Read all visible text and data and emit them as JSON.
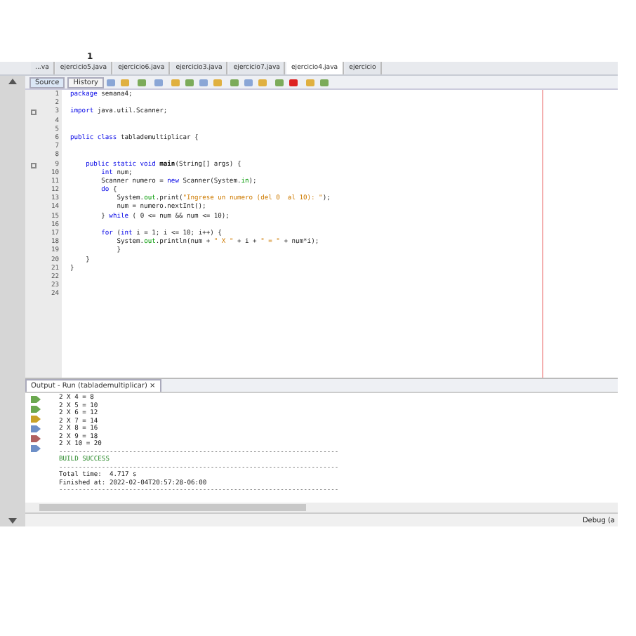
{
  "top_label": "1",
  "tabs": [
    {
      "label": "...va",
      "selected": false
    },
    {
      "label": "ejercicio5.java",
      "selected": false
    },
    {
      "label": "ejercicio6.java",
      "selected": false
    },
    {
      "label": "ejercicio3.java",
      "selected": false
    },
    {
      "label": "ejercicio7.java",
      "selected": false
    },
    {
      "label": "ejercicio4.java",
      "selected": true
    },
    {
      "label": "ejercicio",
      "selected": false
    }
  ],
  "editor_tabs": [
    {
      "label": "Source",
      "selected": true
    },
    {
      "label": "History",
      "selected": false
    }
  ],
  "code": [
    {
      "n": "1",
      "segs": [
        {
          "kind": "kw",
          "t": "package"
        },
        {
          "kind": "p",
          "t": " semana4;"
        }
      ]
    },
    {
      "n": "2"
    },
    {
      "n": "3",
      "fold": true,
      "segs": [
        {
          "kind": "kw",
          "t": "import"
        },
        {
          "kind": "p",
          "t": " java.util.Scanner;"
        }
      ]
    },
    {
      "n": "4"
    },
    {
      "n": "5"
    },
    {
      "n": "6",
      "segs": [
        {
          "kind": "kw",
          "t": "public class"
        },
        {
          "kind": "p",
          "t": " tablademultiplicar {"
        }
      ]
    },
    {
      "n": "7"
    },
    {
      "n": "8"
    },
    {
      "n": "9",
      "fold": true,
      "segs": [
        {
          "kind": "kw",
          "t": "    public static void"
        },
        {
          "kind": "b",
          "t": " main"
        },
        {
          "kind": "p",
          "t": "(String[] args) {"
        }
      ]
    },
    {
      "n": "10",
      "segs": [
        {
          "kind": "kw",
          "t": "        int"
        },
        {
          "kind": "p",
          "t": " num;"
        }
      ]
    },
    {
      "n": "11",
      "segs": [
        {
          "kind": "p",
          "t": "        Scanner numero = "
        },
        {
          "kind": "kw",
          "t": "new"
        },
        {
          "kind": "p",
          "t": " Scanner(System."
        },
        {
          "kind": "f",
          "t": "in"
        },
        {
          "kind": "p",
          "t": ");"
        }
      ]
    },
    {
      "n": "12",
      "segs": [
        {
          "kind": "kw",
          "t": "        do"
        },
        {
          "kind": "p",
          "t": " {"
        }
      ]
    },
    {
      "n": "13",
      "segs": [
        {
          "kind": "p",
          "t": "            System."
        },
        {
          "kind": "f",
          "t": "out"
        },
        {
          "kind": "p",
          "t": ".print("
        },
        {
          "kind": "s",
          "t": "\"Ingrese un numero (del 0  al 10): \""
        },
        {
          "kind": "p",
          "t": ");"
        }
      ]
    },
    {
      "n": "14",
      "segs": [
        {
          "kind": "p",
          "t": "            num = numero.nextInt();"
        }
      ]
    },
    {
      "n": "15",
      "segs": [
        {
          "kind": "p",
          "t": "        } "
        },
        {
          "kind": "kw",
          "t": "while"
        },
        {
          "kind": "p",
          "t": " ( 0 <= num && num <= 10);"
        }
      ]
    },
    {
      "n": "16"
    },
    {
      "n": "17",
      "segs": [
        {
          "kind": "kw",
          "t": "        for"
        },
        {
          "kind": "p",
          "t": " ("
        },
        {
          "kind": "kw",
          "t": "int"
        },
        {
          "kind": "p",
          "t": " i = 1; i <= 10; i++) {"
        }
      ]
    },
    {
      "n": "18",
      "segs": [
        {
          "kind": "p",
          "t": "            System."
        },
        {
          "kind": "f",
          "t": "out"
        },
        {
          "kind": "p",
          "t": ".println(num + "
        },
        {
          "kind": "s",
          "t": "\" X \""
        },
        {
          "kind": "p",
          "t": " + i + "
        },
        {
          "kind": "s",
          "t": "\" = \""
        },
        {
          "kind": "p",
          "t": " + num*i);"
        }
      ]
    },
    {
      "n": "19",
      "segs": [
        {
          "kind": "p",
          "t": "            }"
        }
      ]
    },
    {
      "n": "20",
      "segs": [
        {
          "kind": "p",
          "t": "    }"
        }
      ]
    },
    {
      "n": "21",
      "segs": [
        {
          "kind": "p",
          "t": "}"
        }
      ]
    },
    {
      "n": "22"
    },
    {
      "n": "23"
    },
    {
      "n": "24"
    }
  ],
  "output": {
    "title": "Output - Run (tablademultiplicar)",
    "close": "×",
    "lines": [
      {
        "kind": "text",
        "t": "2 X 4 = 8"
      },
      {
        "kind": "text",
        "t": "2 X 5 = 10"
      },
      {
        "kind": "text",
        "t": "2 X 6 = 12"
      },
      {
        "kind": "text",
        "t": "2 X 7 = 14"
      },
      {
        "kind": "text",
        "t": "2 X 8 = 16"
      },
      {
        "kind": "text",
        "t": "2 X 9 = 18"
      },
      {
        "kind": "text",
        "t": "2 X 10 = 20"
      },
      {
        "kind": "rule",
        "t": "------------------------------------------------------------------------"
      },
      {
        "kind": "success",
        "t": "BUILD SUCCESS"
      },
      {
        "kind": "rule",
        "t": "------------------------------------------------------------------------"
      },
      {
        "kind": "text",
        "t": "Total time:  4.717 s"
      },
      {
        "kind": "text",
        "t": "Finished at: 2022-02-04T20:57:28-06:00"
      },
      {
        "kind": "rule",
        "t": "------------------------------------------------------------------------"
      }
    ]
  },
  "status_bar": {
    "text": "Debug (a"
  }
}
